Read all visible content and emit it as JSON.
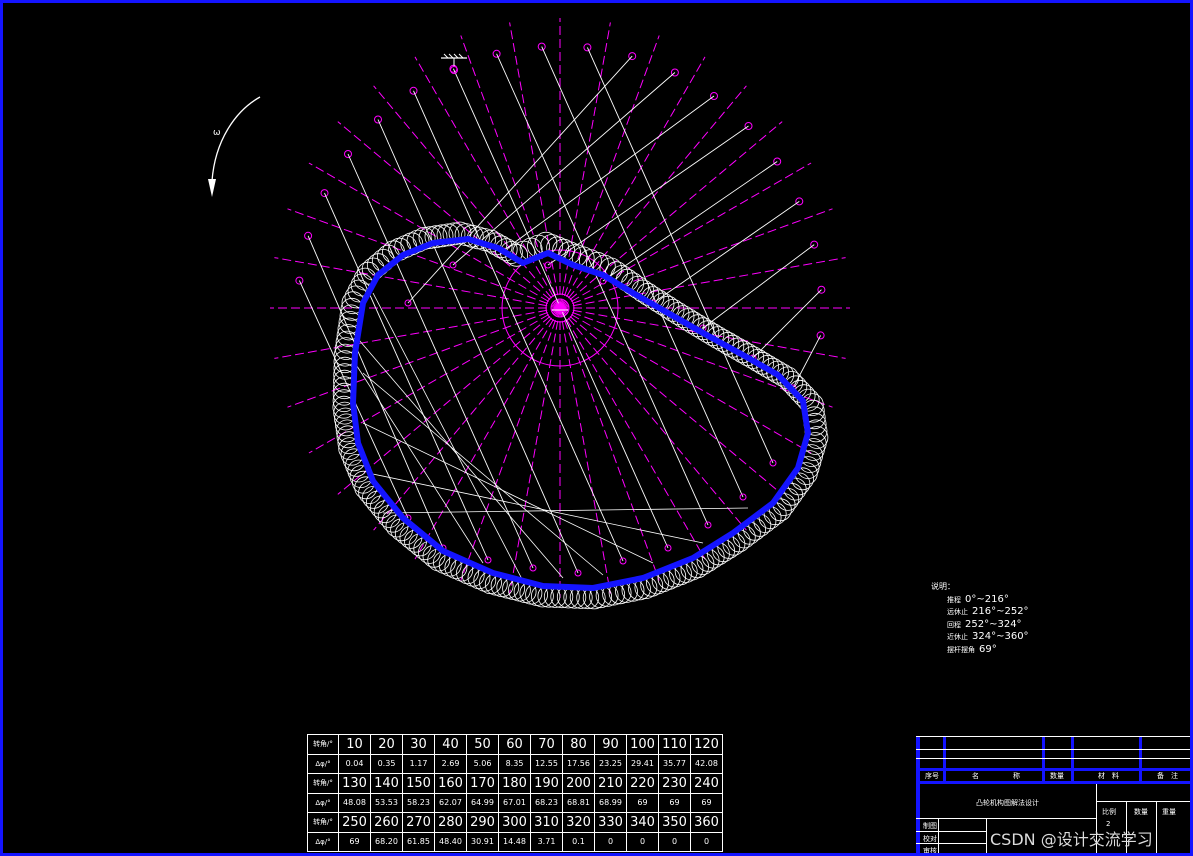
{
  "notes": {
    "header": "说明：",
    "items": [
      {
        "label": "推程",
        "value": "0°~216°"
      },
      {
        "label": "远休止",
        "value": "216°~252°"
      },
      {
        "label": "回程",
        "value": "252°~324°"
      },
      {
        "label": "近休止",
        "value": "324°~360°"
      },
      {
        "label": "摆杆摆角",
        "value": "69°"
      }
    ]
  },
  "table": {
    "angle_label": "转角/°",
    "delta_label": "Δφ/°",
    "angle_row1": [
      "10",
      "20",
      "30",
      "40",
      "50",
      "60",
      "70",
      "80",
      "90",
      "100",
      "110",
      "120"
    ],
    "delta_row1": [
      "0.04",
      "0.35",
      "1.17",
      "2.69",
      "5.06",
      "8.35",
      "12.55",
      "17.56",
      "23.25",
      "29.41",
      "35.77",
      "42.08"
    ],
    "angle_row2": [
      "130",
      "140",
      "150",
      "160",
      "170",
      "180",
      "190",
      "200",
      "210",
      "220",
      "230",
      "240"
    ],
    "delta_row2": [
      "48.08",
      "53.53",
      "58.23",
      "62.07",
      "64.99",
      "67.01",
      "68.23",
      "68.81",
      "68.99",
      "69",
      "69",
      "69"
    ],
    "angle_row3": [
      "250",
      "260",
      "270",
      "280",
      "290",
      "300",
      "310",
      "320",
      "330",
      "340",
      "350",
      "360"
    ],
    "delta_row3": [
      "69",
      "68.20",
      "61.85",
      "48.40",
      "30.91",
      "14.48",
      "3.71",
      "0.1",
      "0",
      "0",
      "0",
      "0"
    ]
  },
  "title_block": {
    "seq": "序号",
    "name_a": "名",
    "name_b": "称",
    "qty": "数量",
    "material_a": "材",
    "material_b": "料",
    "remark_a": "备",
    "remark_b": "注",
    "drawing_title": "凸轮机构图解法设计",
    "scale_label": "比例",
    "scale_value": "2",
    "count_label": "数量",
    "weight_label": "重量",
    "draw_label": "制图",
    "check_label": "校对",
    "review_label": "审核"
  },
  "watermark": "CSDN @设计交流学习",
  "colors": {
    "background": "#000000",
    "frame": "#1414ff",
    "cam_profile": "#1414ff",
    "construction_lines": "#ff00ff",
    "lines": "#ffffff"
  },
  "icons": {
    "rotation": "curved-arrow-icon",
    "pivot": "ground-pivot-icon"
  }
}
